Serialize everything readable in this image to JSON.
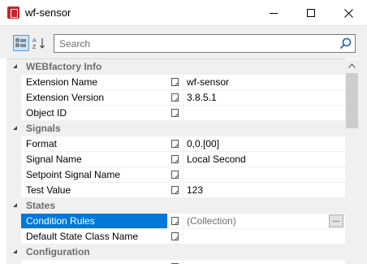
{
  "window": {
    "title": "wf-sensor",
    "icon": "app-icon"
  },
  "toolbar": {
    "categorized_icon": "categorized-view-icon",
    "alphabetical_icon": "alphabetical-sort-icon",
    "search_placeholder": "Search"
  },
  "grid": {
    "categories": [
      {
        "label": "WEBfactory Info",
        "properties": [
          {
            "name": "Extension Name",
            "value": "wf-sensor"
          },
          {
            "name": "Extension Version",
            "value": "3.8.5.1"
          },
          {
            "name": "Object ID",
            "value": ""
          }
        ]
      },
      {
        "label": "Signals",
        "properties": [
          {
            "name": "Format",
            "value": "0,0.[00]"
          },
          {
            "name": "Signal Name",
            "value": "Local Second"
          },
          {
            "name": "Setpoint Signal Name",
            "value": ""
          },
          {
            "name": "Test Value",
            "value": "123"
          }
        ]
      },
      {
        "label": "States",
        "properties": [
          {
            "name": "Condition Rules",
            "value": "(Collection)",
            "selected": true,
            "ellipsis": "..."
          },
          {
            "name": "Default State Class Name",
            "value": ""
          }
        ]
      },
      {
        "label": "Configuration",
        "properties": []
      }
    ]
  },
  "colors": {
    "selection": "#0078d7",
    "category_text": "#6d6d6d",
    "app_icon": "#c1272d"
  }
}
